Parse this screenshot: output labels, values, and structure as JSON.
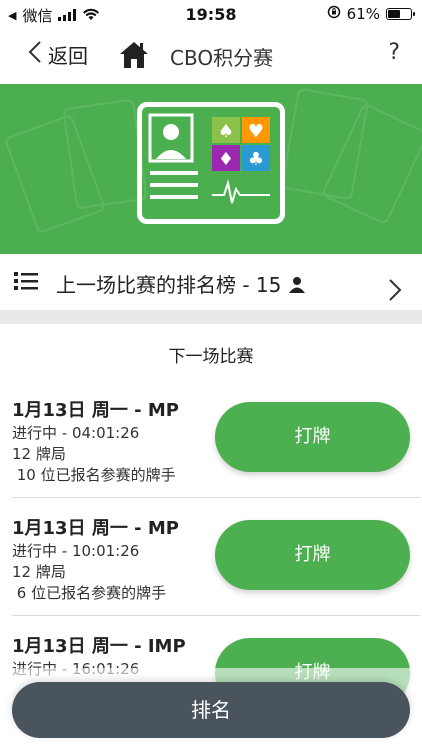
{
  "status_bar": {
    "carrier": "微信",
    "time": "19:58",
    "battery_text": "61%",
    "battery_level": 0.61
  },
  "nav": {
    "back_label": "返回",
    "title": "CBO积分赛",
    "help": "?"
  },
  "leaderboard": {
    "label": "上一场比赛的排名榜 - 15"
  },
  "section_title": "下一场比赛",
  "matches": [
    {
      "name": "1月13日 周一 - MP",
      "status": "进行中 - 04:01:26",
      "boards": "12 牌局",
      "players": " 10 位已报名参赛的牌手",
      "play_label": "打牌"
    },
    {
      "name": "1月13日 周一 - MP",
      "status": "进行中 - 10:01:26",
      "boards": "12 牌局",
      "players": " 6 位已报名参赛的牌手",
      "play_label": "打牌"
    },
    {
      "name": "1月13日 周一 - IMP",
      "status": "进行中 - 16:01:26",
      "play_label": "打牌"
    }
  ],
  "bottom_button": "排名",
  "colors": {
    "accent": "#4caf50",
    "bottom": "#4a545c"
  }
}
